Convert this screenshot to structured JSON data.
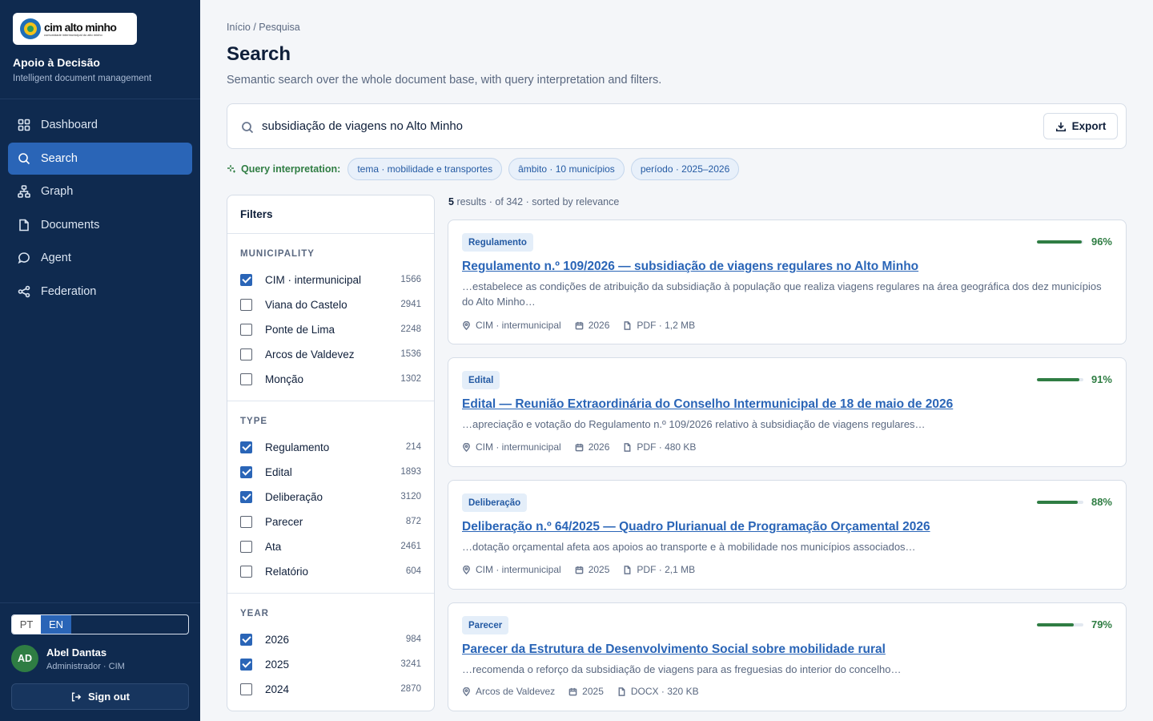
{
  "sidebar": {
    "logo": {
      "main": "cim alto minho",
      "sub": "comunidade intermunicipal do alto minho"
    },
    "brand_title": "Apoio à Decisão",
    "brand_subtitle": "Intelligent document management",
    "nav": [
      {
        "label": "Dashboard",
        "icon": "grid-icon",
        "active": false
      },
      {
        "label": "Search",
        "icon": "search-icon",
        "active": true
      },
      {
        "label": "Graph",
        "icon": "graph-icon",
        "active": false
      },
      {
        "label": "Documents",
        "icon": "document-icon",
        "active": false
      },
      {
        "label": "Agent",
        "icon": "chat-icon",
        "active": false
      },
      {
        "label": "Federation",
        "icon": "share-icon",
        "active": false
      }
    ],
    "lang": {
      "pt": "PT",
      "en": "EN",
      "selected": "EN"
    },
    "user": {
      "initials": "AD",
      "name": "Abel Dantas",
      "role": "Administrador · CIM"
    },
    "signout_label": "Sign out"
  },
  "header": {
    "breadcrumb": "Início / Pesquisa",
    "title": "Search",
    "subtitle": "Semantic search over the whole document base, with query interpretation and filters."
  },
  "search": {
    "query": "subsidiação de viagens no Alto Minho",
    "export_label": "Export"
  },
  "interpretation": {
    "label": "Query interpretation:",
    "chips": [
      "tema · mobilidade e transportes",
      "âmbito · 10 municípios",
      "período · 2025–2026"
    ]
  },
  "filters": {
    "title": "Filters",
    "groups": [
      {
        "title": "MUNICIPALITY",
        "items": [
          {
            "label": "CIM · intermunicipal",
            "count": "1566",
            "checked": true
          },
          {
            "label": "Viana do Castelo",
            "count": "2941",
            "checked": false
          },
          {
            "label": "Ponte de Lima",
            "count": "2248",
            "checked": false
          },
          {
            "label": "Arcos de Valdevez",
            "count": "1536",
            "checked": false
          },
          {
            "label": "Monção",
            "count": "1302",
            "checked": false
          }
        ]
      },
      {
        "title": "TYPE",
        "items": [
          {
            "label": "Regulamento",
            "count": "214",
            "checked": true
          },
          {
            "label": "Edital",
            "count": "1893",
            "checked": true
          },
          {
            "label": "Deliberação",
            "count": "3120",
            "checked": true
          },
          {
            "label": "Parecer",
            "count": "872",
            "checked": false
          },
          {
            "label": "Ata",
            "count": "2461",
            "checked": false
          },
          {
            "label": "Relatório",
            "count": "604",
            "checked": false
          }
        ]
      },
      {
        "title": "YEAR",
        "items": [
          {
            "label": "2026",
            "count": "984",
            "checked": true
          },
          {
            "label": "2025",
            "count": "3241",
            "checked": true
          },
          {
            "label": "2024",
            "count": "2870",
            "checked": false
          }
        ]
      }
    ]
  },
  "results": {
    "count": "5",
    "summary_rest": "results · of 342 · sorted by relevance",
    "items": [
      {
        "tag": "Regulamento",
        "score": 96,
        "score_label": "96%",
        "title": "Regulamento n.º 109/2026 — subsidiação de viagens regulares no Alto Minho",
        "snippet": "…estabelece as condições de atribuição da subsidiação à população que realiza viagens regulares na área geográfica dos dez municípios do Alto Minho…",
        "location": "CIM · intermunicipal",
        "year": "2026",
        "file": "PDF · 1,2 MB"
      },
      {
        "tag": "Edital",
        "score": 91,
        "score_label": "91%",
        "title": "Edital — Reunião Extraordinária do Conselho Intermunicipal de 18 de maio de 2026",
        "snippet": "…apreciação e votação do Regulamento n.º 109/2026 relativo à subsidiação de viagens regulares…",
        "location": "CIM · intermunicipal",
        "year": "2026",
        "file": "PDF · 480 KB"
      },
      {
        "tag": "Deliberação",
        "score": 88,
        "score_label": "88%",
        "title": "Deliberação n.º 64/2025 — Quadro Plurianual de Programação Orçamental 2026",
        "snippet": "…dotação orçamental afeta aos apoios ao transporte e à mobilidade nos municípios associados…",
        "location": "CIM · intermunicipal",
        "year": "2025",
        "file": "PDF · 2,1 MB"
      },
      {
        "tag": "Parecer",
        "score": 79,
        "score_label": "79%",
        "title": "Parecer da Estrutura de Desenvolvimento Social sobre mobilidade rural",
        "snippet": "…recomenda o reforço da subsidiação de viagens para as freguesias do interior do concelho…",
        "location": "Arcos de Valdevez",
        "year": "2025",
        "file": "DOCX · 320 KB"
      }
    ]
  }
}
